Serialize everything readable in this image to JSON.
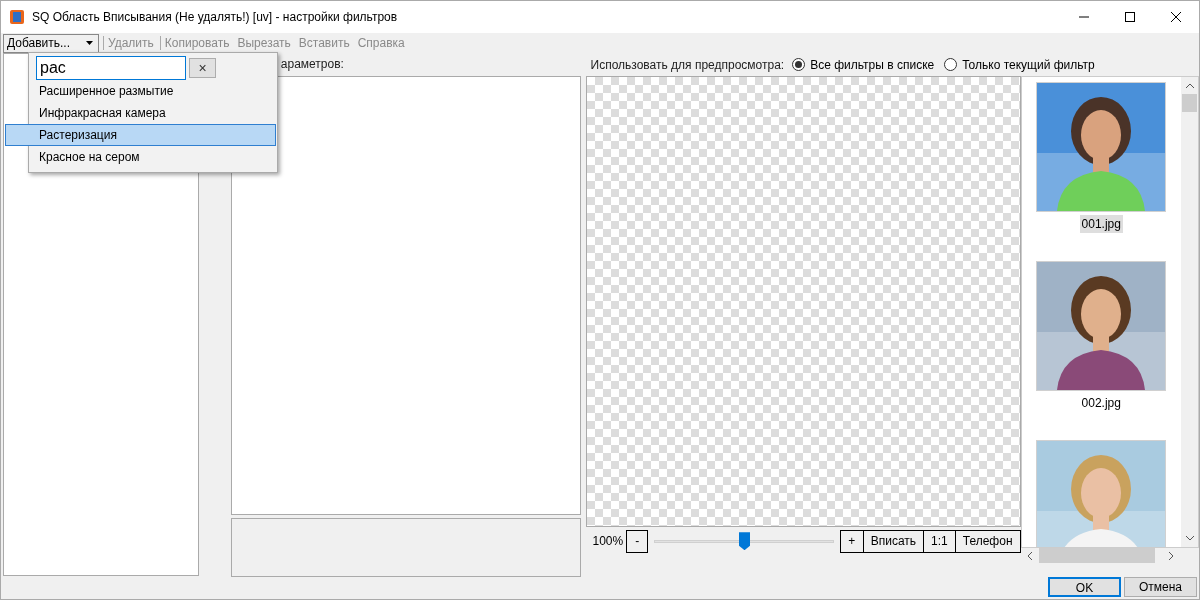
{
  "window": {
    "title": "SQ Область Вписывания (Не удалять!) [uv] - настройки фильтров"
  },
  "toolbar": {
    "add_button": "Добавить...",
    "items": [
      {
        "label": "Удалить",
        "disabled": true
      },
      {
        "label": "Копировать",
        "disabled": true
      },
      {
        "label": "Вырезать",
        "disabled": true
      },
      {
        "label": "Вставить",
        "disabled": true
      },
      {
        "label": "Справка",
        "disabled": true
      }
    ]
  },
  "add_dropdown": {
    "search_value": "рас",
    "clear": "×",
    "items": [
      {
        "label": "Расширенное размытие",
        "selected": false
      },
      {
        "label": "Инфракрасная камера",
        "selected": false
      },
      {
        "label": "Растеризация",
        "selected": true
      },
      {
        "label": "Красное на сером",
        "selected": false
      }
    ]
  },
  "params": {
    "label": "араметров:"
  },
  "preview": {
    "label": "Использовать для предпросмотра:",
    "options": [
      {
        "label": "Все фильтры в списке",
        "selected": true
      },
      {
        "label": "Только текущий фильтр",
        "selected": false
      }
    ]
  },
  "thumbnails": [
    {
      "name": "001.jpg",
      "selected": true,
      "kind": "picture"
    },
    {
      "name": "002.jpg",
      "selected": false,
      "kind": "picture"
    },
    {
      "kind": "picture"
    }
  ],
  "zoom": {
    "reading": "100%",
    "minus": "-",
    "level": 0.5,
    "plus": "+",
    "buttons": [
      "Вписать",
      "1:1",
      "Телефон"
    ]
  },
  "dialog_buttons": [
    {
      "label": "OK",
      "default": true
    },
    {
      "label": "Отмена",
      "default": false
    }
  ]
}
